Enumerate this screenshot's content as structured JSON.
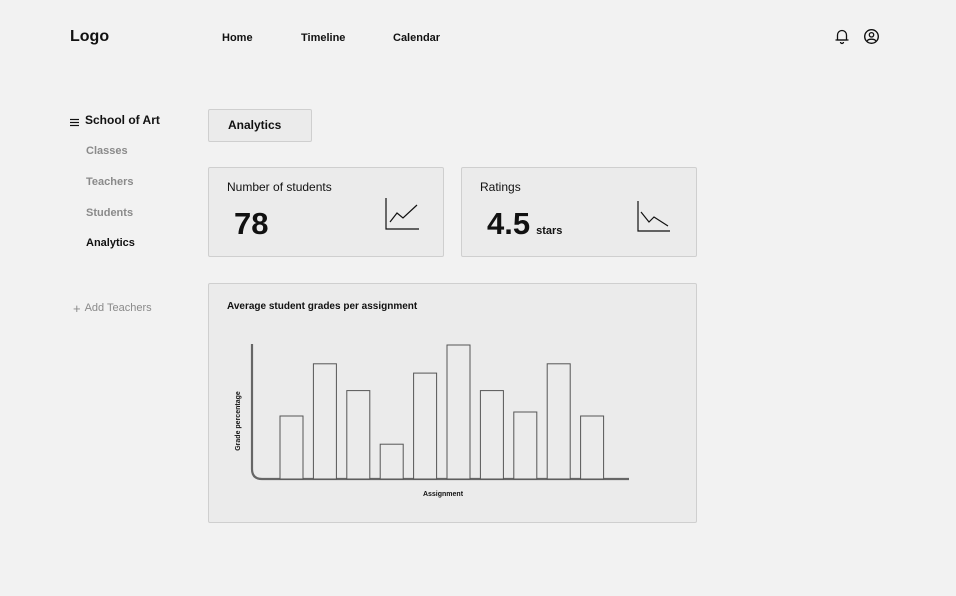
{
  "header": {
    "logo": "Logo",
    "nav": [
      {
        "label": "Home"
      },
      {
        "label": "Timeline"
      },
      {
        "label": "Calendar"
      }
    ],
    "icons": [
      "bell-icon",
      "user-circle-icon"
    ]
  },
  "sidebar": {
    "title": "School of Art",
    "menu_icon": "hamburger-icon",
    "items": [
      {
        "label": "Classes",
        "active": false
      },
      {
        "label": "Teachers",
        "active": false
      },
      {
        "label": "Students",
        "active": false
      },
      {
        "label": "Analytics",
        "active": true
      }
    ],
    "add_label": "Add Teachers"
  },
  "main": {
    "tab": "Analytics",
    "stats": [
      {
        "title": "Number of students",
        "value": "78",
        "unit": "",
        "trend_icon": "trend-up-icon"
      },
      {
        "title": "Ratings",
        "value": "4.5",
        "unit": "stars",
        "trend_icon": "trend-down-icon"
      }
    ]
  },
  "chart_data": {
    "type": "bar",
    "title": "Average student grades per assignment",
    "xlabel": "Assignment",
    "ylabel": "Grade percentage",
    "values": [
      47,
      86,
      66,
      26,
      79,
      100,
      66,
      50,
      86,
      47
    ],
    "ylim": [
      0,
      100
    ],
    "grid": false
  }
}
